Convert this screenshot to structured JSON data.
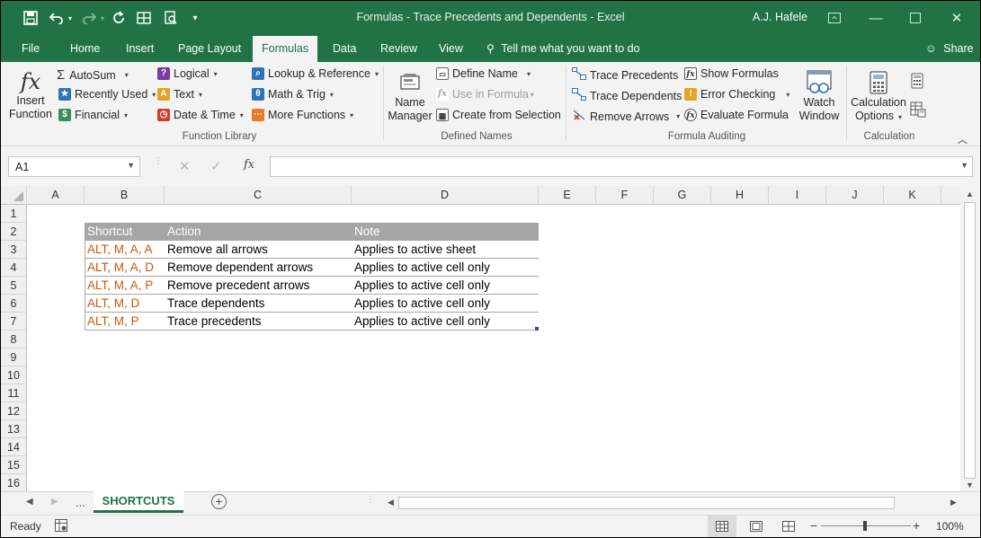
{
  "window": {
    "title": "Formulas - Trace Precedents and Dependents  -  Excel",
    "user": "A.J. Hafele"
  },
  "tabs": [
    "File",
    "Home",
    "Insert",
    "Page Layout",
    "Formulas",
    "Data",
    "Review",
    "View"
  ],
  "active_tab": "Formulas",
  "tell_me": "Tell me what you want to do",
  "share": "Share",
  "ribbon": {
    "insert_function": [
      "Insert",
      "Function"
    ],
    "function_library": {
      "autosum": "AutoSum",
      "recently_used": "Recently Used",
      "financial": "Financial",
      "logical": "Logical",
      "text": "Text",
      "date_time": "Date & Time",
      "lookup": "Lookup & Reference",
      "math": "Math & Trig",
      "more": "More Functions",
      "label": "Function Library"
    },
    "defined_names": {
      "name_manager": [
        "Name",
        "Manager"
      ],
      "define_name": "Define Name",
      "use_in_formula": "Use in Formula",
      "create_from_selection": "Create from Selection",
      "label": "Defined Names"
    },
    "formula_auditing": {
      "trace_precedents": "Trace Precedents",
      "trace_dependents": "Trace Dependents",
      "remove_arrows": "Remove Arrows",
      "show_formulas": "Show Formulas",
      "error_checking": "Error Checking",
      "evaluate_formula": "Evaluate Formula",
      "watch_window": [
        "Watch",
        "Window"
      ],
      "label": "Formula Auditing"
    },
    "calculation": {
      "options": [
        "Calculation",
        "Options"
      ],
      "label": "Calculation"
    }
  },
  "name_box": "A1",
  "fx_label": "fx",
  "formula_value": "",
  "columns": [
    "A",
    "B",
    "C",
    "D",
    "E",
    "F",
    "G",
    "H",
    "I",
    "J",
    "K"
  ],
  "rows": [
    "1",
    "2",
    "3",
    "4",
    "5",
    "6",
    "7",
    "8",
    "9",
    "10",
    "11",
    "12",
    "13",
    "14",
    "15",
    "16"
  ],
  "table": {
    "headers": [
      "Shortcut",
      "Action",
      "Note"
    ],
    "rows": [
      [
        "ALT, M, A, A",
        "Remove all arrows",
        "Applies to active sheet"
      ],
      [
        "ALT, M, A, D",
        "Remove dependent arrows",
        "Applies to active cell only"
      ],
      [
        "ALT, M, A, P",
        "Remove precedent arrows",
        "Applies to active cell only"
      ],
      [
        "ALT, M, D",
        "Trace dependents",
        "Applies to active cell only"
      ],
      [
        "ALT, M, P",
        "Trace precedents",
        "Applies to active cell only"
      ]
    ]
  },
  "sheet_tab_ellipsis": "...",
  "sheet_tab": "SHORTCUTS",
  "status": {
    "ready": "Ready",
    "zoom": "100%"
  },
  "colors": {
    "excel_green": "#217346",
    "header_gray": "#a6a6a6",
    "shortcut_orange": "#c65911"
  }
}
